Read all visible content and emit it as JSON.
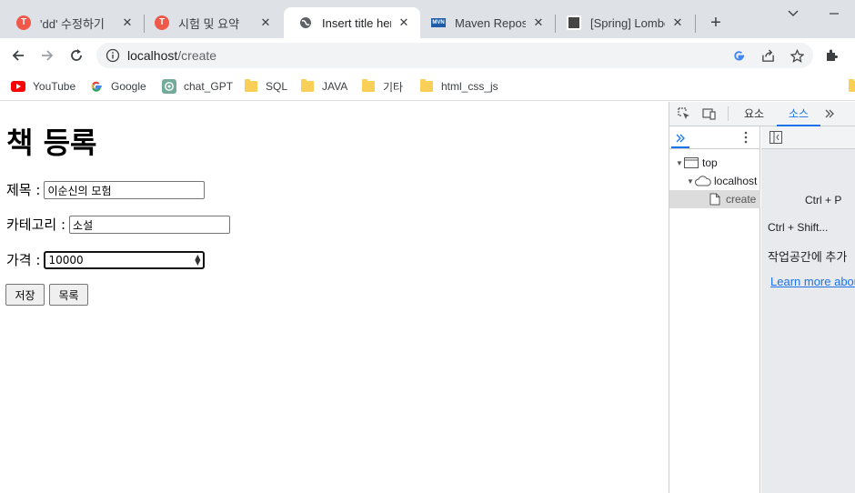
{
  "tabs": [
    {
      "title": "'dd' 수정하기",
      "icon": "red-app-icon"
    },
    {
      "title": "시험 및 요약",
      "icon": "red-app-icon"
    },
    {
      "title": "Insert title here",
      "icon": "globe-icon"
    },
    {
      "title": "Maven Reposito",
      "icon": "mvn-icon"
    },
    {
      "title": "[Spring] Lombo",
      "icon": "site-image-icon"
    }
  ],
  "toolbar": {
    "url_host": "localhost",
    "url_path": "/create"
  },
  "bookmarks": [
    {
      "label": "YouTube",
      "icon": "youtube-icon"
    },
    {
      "label": "Google",
      "icon": "google-icon"
    },
    {
      "label": "chat_GPT",
      "icon": "chatgpt-icon"
    },
    {
      "label": "SQL",
      "icon": "folder-icon"
    },
    {
      "label": "JAVA",
      "icon": "folder-icon"
    },
    {
      "label": "기타",
      "icon": "folder-icon"
    },
    {
      "label": "html_css_js",
      "icon": "folder-icon"
    }
  ],
  "page": {
    "heading": "책 등록",
    "form": {
      "title_label": "제목 :",
      "title_value": "이순신의 모험",
      "category_label": "카테고리 :",
      "category_value": "소설",
      "price_label": "가격 :",
      "price_value": "10000"
    },
    "buttons": {
      "save": "저장",
      "list": "목록"
    }
  },
  "devtools": {
    "tabs": {
      "elements": "요소",
      "sources": "소스"
    },
    "tree": {
      "top": "top",
      "host": "localhost",
      "file": "create"
    },
    "editor": {
      "shortcut1": "Ctrl + P",
      "shortcut2": "Ctrl + Shift...",
      "workspace": "작업공간에 추가",
      "learn_more": "Learn more about"
    }
  }
}
